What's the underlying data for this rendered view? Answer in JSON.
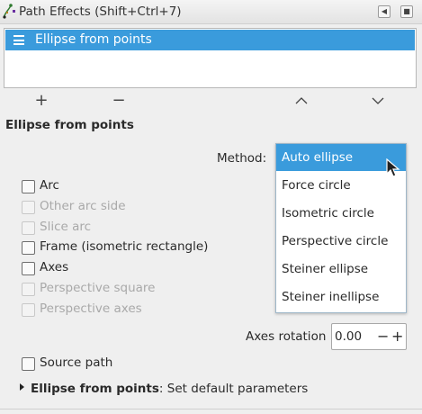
{
  "window": {
    "title": "Path Effects (Shift+Ctrl+7)"
  },
  "titlebar": {
    "left_button_icon": "triangle-left-icon",
    "close_button_icon": "close-icon"
  },
  "effects_list": {
    "items": [
      {
        "label": "Ellipse from points",
        "icon": "hamburger-icon",
        "selected": true
      }
    ]
  },
  "list_controls": {
    "add": "+",
    "remove": "−",
    "up": "chevron-up-icon",
    "down": "chevron-down-icon"
  },
  "effect": {
    "title": "Ellipse from points",
    "method": {
      "label": "Method:",
      "options": [
        "Auto ellipse",
        "Force circle",
        "Isometric circle",
        "Perspective circle",
        "Steiner ellipse",
        "Steiner inellipse"
      ],
      "selected": "Auto ellipse"
    },
    "options": [
      {
        "label": "Arc",
        "checked": false,
        "enabled": true
      },
      {
        "label": "Other arc side",
        "checked": false,
        "enabled": false
      },
      {
        "label": "Slice arc",
        "checked": false,
        "enabled": false
      },
      {
        "label": "Frame (isometric rectangle)",
        "checked": false,
        "enabled": true
      },
      {
        "label": "Axes",
        "checked": false,
        "enabled": true
      },
      {
        "label": "Perspective square",
        "checked": false,
        "enabled": false
      },
      {
        "label": "Perspective axes",
        "checked": false,
        "enabled": false
      }
    ],
    "axes_rotation": {
      "label": "Axes rotation",
      "value": "0.00",
      "minus": "−",
      "plus": "+"
    },
    "source_path": {
      "label": "Source path",
      "checked": false
    },
    "defaults": {
      "name": "Ellipse from points",
      "suffix": ": Set default parameters"
    }
  },
  "colors": {
    "selection": "#3a9bdc",
    "background": "#efefef"
  }
}
